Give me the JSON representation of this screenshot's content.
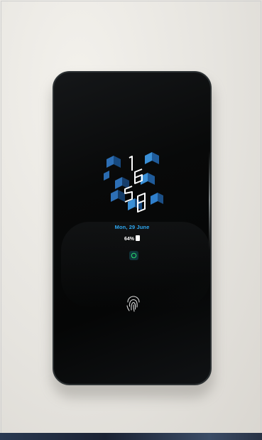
{
  "lock_screen": {
    "date": "Mon, 29 June",
    "battery": "64%",
    "clock_digits": [
      "1",
      "6",
      "5",
      "8"
    ]
  },
  "icons": {
    "notification": "whatsapp-icon",
    "unlock": "fingerprint-icon",
    "battery": "battery-icon"
  },
  "colors": {
    "accent": "#2ea7f0",
    "cube_dark": "#1f4f8a",
    "cube_light": "#3a8fd6",
    "screen": "#050606"
  }
}
